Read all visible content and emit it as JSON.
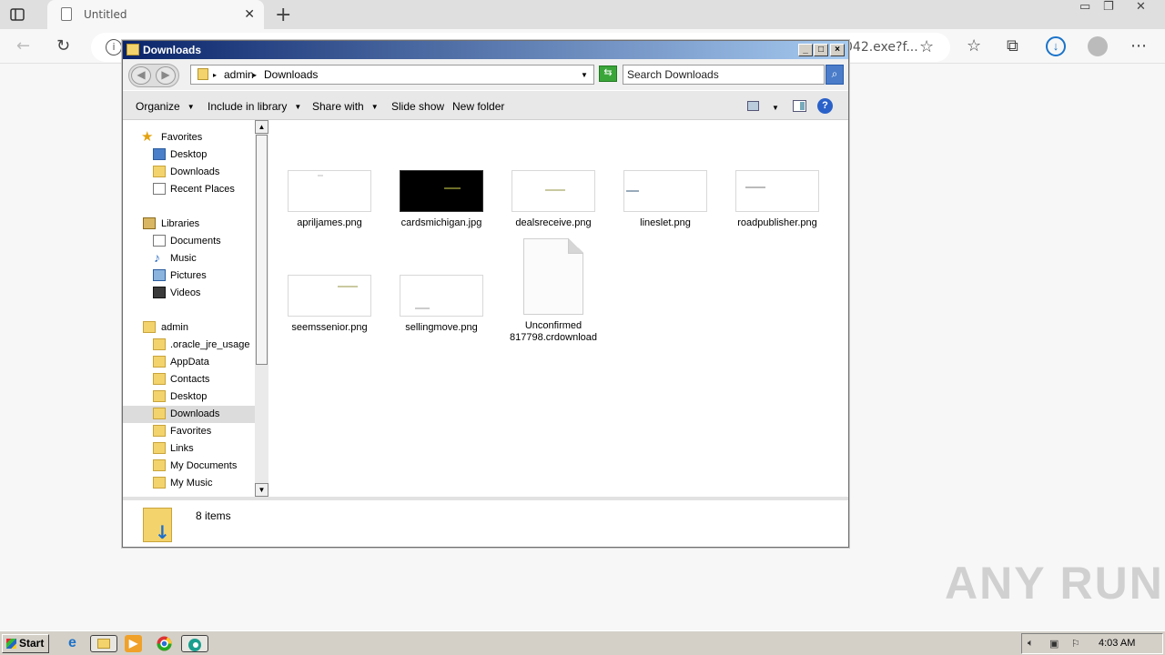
{
  "browser": {
    "tab_title": "Untitled",
    "url_fragment": "042.exe?f...",
    "colors": {
      "download_accent": "#1a73c9"
    }
  },
  "explorer": {
    "window_title": "Downloads",
    "breadcrumb": [
      "admin",
      "Downloads"
    ],
    "search_placeholder": "Search Downloads",
    "toolbar": {
      "organize": "Organize",
      "include_in_library": "Include in library",
      "share_with": "Share with",
      "slide_show": "Slide show",
      "new_folder": "New folder"
    },
    "nav": {
      "favorites": {
        "label": "Favorites",
        "items": [
          "Desktop",
          "Downloads",
          "Recent Places"
        ]
      },
      "libraries": {
        "label": "Libraries",
        "items": [
          "Documents",
          "Music",
          "Pictures",
          "Videos"
        ]
      },
      "admin": {
        "label": "admin",
        "items": [
          ".oracle_jre_usage",
          "AppData",
          "Contacts",
          "Desktop",
          "Downloads",
          "Favorites",
          "Links",
          "My Documents",
          "My Music"
        ]
      }
    },
    "files": [
      {
        "name": "apriljames.png"
      },
      {
        "name": "cardsmichigan.jpg"
      },
      {
        "name": "dealsreceive.png"
      },
      {
        "name": "lineslet.png"
      },
      {
        "name": "roadpublisher.png"
      },
      {
        "name": "seemssenior.png"
      },
      {
        "name": "sellingmove.png"
      },
      {
        "name_line1": "Unconfirmed",
        "name_line2": "817798.crdownload"
      }
    ],
    "status": "8 items"
  },
  "watermark": "ANY RUN",
  "taskbar": {
    "start": "Start",
    "clock": "4:03 AM"
  }
}
